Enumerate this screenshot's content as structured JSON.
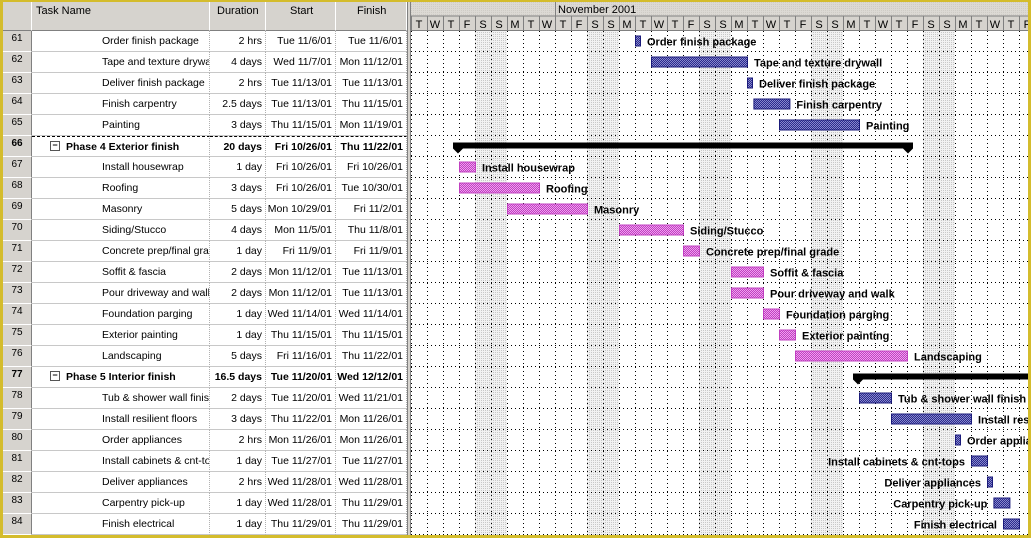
{
  "columns": {
    "id": "",
    "name": "Task Name",
    "duration": "Duration",
    "start": "Start",
    "finish": "Finish"
  },
  "timescale": {
    "major_label": "November 2001",
    "first_visible_date": "2001-10-23",
    "major_start_date": "2001-11-01",
    "days": [
      "T",
      "W",
      "T",
      "F",
      "S",
      "S",
      "M",
      "T",
      "W",
      "T",
      "F",
      "S",
      "S",
      "M",
      "T",
      "W",
      "T",
      "F",
      "S",
      "S",
      "M",
      "T",
      "W",
      "T",
      "F",
      "S",
      "S",
      "M",
      "T",
      "W",
      "T",
      "F",
      "S",
      "S",
      "M",
      "T",
      "W",
      "T",
      "F"
    ]
  },
  "colors": {
    "frame": "#d4bc2c",
    "header_gray": "#d6d3ce",
    "task_bar_blue": "#3a3a9c",
    "task_bar_pink": "#cc55cc",
    "summary_bar": "#000000",
    "weekend_shade": "#e8e8e8"
  },
  "tasks": [
    {
      "id": "61",
      "name": "Order finish package",
      "duration": "2 hrs",
      "start": "Tue 11/6/01",
      "finish": "Tue 11/6/01",
      "summary": false,
      "indent": 2,
      "bar": {
        "start": "2001-11-06",
        "days": 0.25,
        "color": "blue",
        "label": "Order finish package",
        "label_side": "right"
      }
    },
    {
      "id": "62",
      "name": "Tape and texture drywall",
      "duration": "4 days",
      "start": "Wed 11/7/01",
      "finish": "Mon 11/12/01",
      "summary": false,
      "indent": 2,
      "bar": {
        "start": "2001-11-07",
        "days": 6,
        "color": "blue",
        "label": "Tape and texture drywall",
        "label_side": "right"
      }
    },
    {
      "id": "63",
      "name": "Deliver finish package",
      "duration": "2 hrs",
      "start": "Tue 11/13/01",
      "finish": "Tue 11/13/01",
      "summary": false,
      "indent": 2,
      "bar": {
        "start": "2001-11-13",
        "days": 0.25,
        "color": "blue",
        "label": "Deliver finish package",
        "label_side": "right"
      }
    },
    {
      "id": "64",
      "name": "Finish carpentry",
      "duration": "2.5 days",
      "start": "Tue 11/13/01",
      "finish": "Thu 11/15/01",
      "summary": false,
      "indent": 2,
      "bar": {
        "start": "2001-11-13.4",
        "days": 2.25,
        "color": "blue",
        "label": "Finish carpentry",
        "label_side": "right"
      }
    },
    {
      "id": "65",
      "name": "Painting",
      "duration": "3 days",
      "start": "Thu 11/15/01",
      "finish": "Mon 11/19/01",
      "summary": false,
      "indent": 2,
      "bar": {
        "start": "2001-11-15",
        "days": 5,
        "color": "blue",
        "label": "Painting",
        "label_side": "right"
      }
    },
    {
      "id": "66",
      "name": "Phase 4 Exterior finish",
      "duration": "20 days",
      "start": "Fri 10/26/01",
      "finish": "Thu 11/22/01",
      "summary": true,
      "indent": 1,
      "bar": {
        "start": "2001-10-26",
        "days": 28,
        "color": "summary",
        "label": "",
        "label_side": "right"
      }
    },
    {
      "id": "67",
      "name": "Install housewrap",
      "duration": "1 day",
      "start": "Fri 10/26/01",
      "finish": "Fri 10/26/01",
      "summary": false,
      "indent": 2,
      "bar": {
        "start": "2001-10-26",
        "days": 1,
        "color": "pink",
        "label": "Install housewrap",
        "label_side": "right"
      }
    },
    {
      "id": "68",
      "name": "Roofing",
      "duration": "3 days",
      "start": "Fri 10/26/01",
      "finish": "Tue 10/30/01",
      "summary": false,
      "indent": 2,
      "bar": {
        "start": "2001-10-26",
        "days": 5,
        "color": "pink",
        "label": "Roofing",
        "label_side": "right"
      }
    },
    {
      "id": "69",
      "name": "Masonry",
      "duration": "5 days",
      "start": "Mon 10/29/01",
      "finish": "Fri 11/2/01",
      "summary": false,
      "indent": 2,
      "bar": {
        "start": "2001-10-29",
        "days": 5,
        "color": "pink",
        "label": "Masonry",
        "label_side": "right"
      }
    },
    {
      "id": "70",
      "name": "Siding/Stucco",
      "duration": "4 days",
      "start": "Mon 11/5/01",
      "finish": "Thu 11/8/01",
      "summary": false,
      "indent": 2,
      "bar": {
        "start": "2001-11-05",
        "days": 4,
        "color": "pink",
        "label": "Siding/Stucco",
        "label_side": "right"
      }
    },
    {
      "id": "71",
      "name": "Concrete prep/final grade",
      "duration": "1 day",
      "start": "Fri 11/9/01",
      "finish": "Fri 11/9/01",
      "summary": false,
      "indent": 2,
      "bar": {
        "start": "2001-11-09",
        "days": 1,
        "color": "pink",
        "label": "Concrete prep/final grade",
        "label_side": "right"
      }
    },
    {
      "id": "72",
      "name": "Soffit & fascia",
      "duration": "2 days",
      "start": "Mon 11/12/01",
      "finish": "Tue 11/13/01",
      "summary": false,
      "indent": 2,
      "bar": {
        "start": "2001-11-12",
        "days": 2,
        "color": "pink",
        "label": "Soffit & fascia",
        "label_side": "right"
      }
    },
    {
      "id": "73",
      "name": "Pour driveway and walk",
      "duration": "2 days",
      "start": "Mon 11/12/01",
      "finish": "Tue 11/13/01",
      "summary": false,
      "indent": 2,
      "bar": {
        "start": "2001-11-12",
        "days": 2,
        "color": "pink",
        "label": "Pour driveway and walk",
        "label_side": "right"
      }
    },
    {
      "id": "74",
      "name": "Foundation parging",
      "duration": "1 day",
      "start": "Wed 11/14/01",
      "finish": "Wed 11/14/01",
      "summary": false,
      "indent": 2,
      "bar": {
        "start": "2001-11-14",
        "days": 1,
        "color": "pink",
        "label": "Foundation parging",
        "label_side": "right"
      }
    },
    {
      "id": "75",
      "name": "Exterior painting",
      "duration": "1 day",
      "start": "Thu 11/15/01",
      "finish": "Thu 11/15/01",
      "summary": false,
      "indent": 2,
      "bar": {
        "start": "2001-11-15",
        "days": 1,
        "color": "pink",
        "label": "Exterior painting",
        "label_side": "right"
      }
    },
    {
      "id": "76",
      "name": "Landscaping",
      "duration": "5 days",
      "start": "Fri 11/16/01",
      "finish": "Thu 11/22/01",
      "summary": false,
      "indent": 2,
      "bar": {
        "start": "2001-11-16",
        "days": 7,
        "color": "pink",
        "label": "Landscaping",
        "label_side": "right"
      }
    },
    {
      "id": "77",
      "name": "Phase 5 Interior finish",
      "duration": "16.5 days",
      "start": "Tue 11/20/01",
      "finish": "Wed 12/12/01",
      "summary": true,
      "indent": 1,
      "bar": {
        "start": "2001-11-20",
        "days": 23,
        "color": "summary",
        "label": "",
        "label_side": "right"
      }
    },
    {
      "id": "78",
      "name": "Tub & shower wall finish",
      "duration": "2 days",
      "start": "Tue 11/20/01",
      "finish": "Wed 11/21/01",
      "summary": false,
      "indent": 2,
      "bar": {
        "start": "2001-11-20",
        "days": 2,
        "color": "blue",
        "label": "Tub & shower wall finish",
        "label_side": "right"
      }
    },
    {
      "id": "79",
      "name": "Install resilient floors",
      "duration": "3 days",
      "start": "Thu 11/22/01",
      "finish": "Mon 11/26/01",
      "summary": false,
      "indent": 2,
      "bar": {
        "start": "2001-11-22",
        "days": 5,
        "color": "blue",
        "label": "Install resilient floors",
        "label_side": "right"
      }
    },
    {
      "id": "80",
      "name": "Order appliances",
      "duration": "2 hrs",
      "start": "Mon 11/26/01",
      "finish": "Mon 11/26/01",
      "summary": false,
      "indent": 2,
      "bar": {
        "start": "2001-11-26",
        "days": 0.25,
        "color": "blue",
        "label": "Order appliances",
        "label_side": "right"
      }
    },
    {
      "id": "81",
      "name": "Install cabinets & cnt-tops",
      "duration": "1 day",
      "start": "Tue 11/27/01",
      "finish": "Tue 11/27/01",
      "summary": false,
      "indent": 2,
      "bar": {
        "start": "2001-11-27",
        "days": 1,
        "color": "blue",
        "label": "Install cabinets & cnt-tops",
        "label_side": "left"
      }
    },
    {
      "id": "82",
      "name": "Deliver appliances",
      "duration": "2 hrs",
      "start": "Wed 11/28/01",
      "finish": "Wed 11/28/01",
      "summary": false,
      "indent": 2,
      "bar": {
        "start": "2001-11-28",
        "days": 0.25,
        "color": "blue",
        "label": "Deliver appliances",
        "label_side": "left"
      }
    },
    {
      "id": "83",
      "name": "Carpentry pick-up",
      "duration": "1 day",
      "start": "Wed 11/28/01",
      "finish": "Thu 11/29/01",
      "summary": false,
      "indent": 2,
      "bar": {
        "start": "2001-11-28.4",
        "days": 1,
        "color": "blue",
        "label": "Carpentry pick-up",
        "label_side": "left"
      }
    },
    {
      "id": "84",
      "name": "Finish electrical",
      "duration": "1 day",
      "start": "Thu 11/29/01",
      "finish": "Thu 11/29/01",
      "summary": false,
      "indent": 2,
      "bar": {
        "start": "2001-11-29",
        "days": 1,
        "color": "blue",
        "label": "Finish electrical",
        "label_side": "left"
      }
    }
  ]
}
